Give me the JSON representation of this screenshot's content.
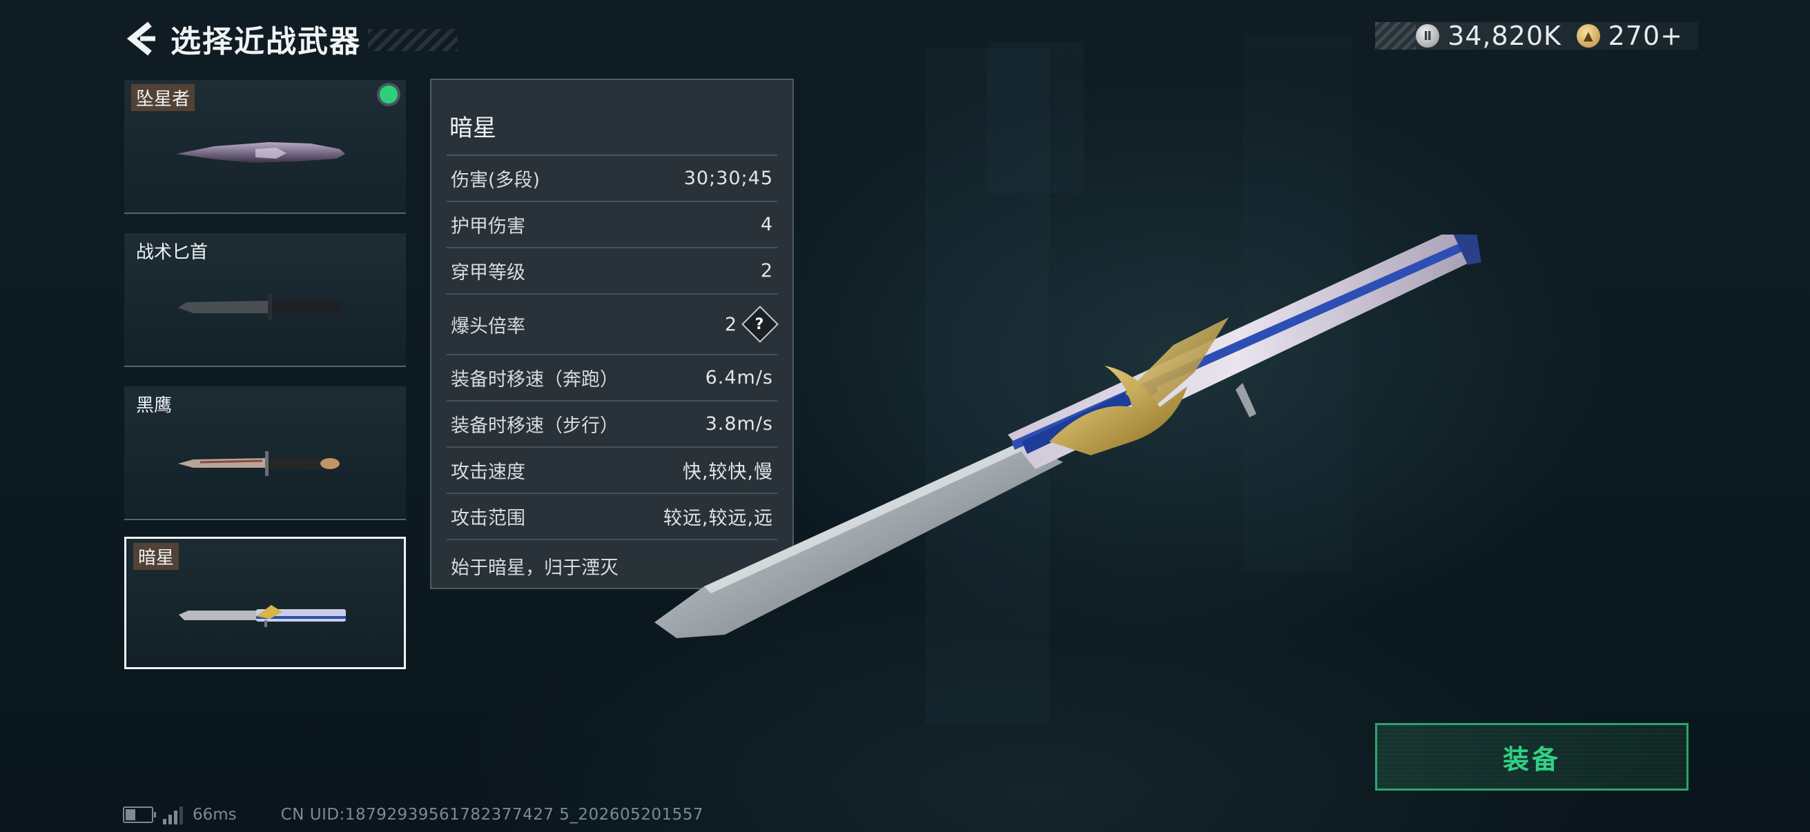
{
  "header": {
    "title": "选择近战武器"
  },
  "currency": {
    "silver": {
      "icon": "silver-coin-icon",
      "value": "34,820K"
    },
    "gold": {
      "icon": "gold-triangle-coin-icon",
      "value": "270+"
    }
  },
  "weapons": [
    {
      "name": "坠星者",
      "equipped": true,
      "selected": false
    },
    {
      "name": "战术匕首",
      "equipped": false,
      "selected": false
    },
    {
      "name": "黑鹰",
      "equipped": false,
      "selected": false
    },
    {
      "name": "暗星",
      "equipped": false,
      "selected": true
    }
  ],
  "stats": {
    "title": "暗星",
    "rows": [
      {
        "label": "伤害(多段)",
        "value": "30;30;45"
      },
      {
        "label": "护甲伤害",
        "value": "4"
      },
      {
        "label": "穿甲等级",
        "value": "2"
      },
      {
        "label": "爆头倍率",
        "value": "2",
        "help_icon": "?"
      },
      {
        "label": "装备时移速（奔跑）",
        "value": "6.4m/s"
      },
      {
        "label": "装备时移速（步行）",
        "value": "3.8m/s"
      },
      {
        "label": "攻击速度",
        "value": "快,较快,慢"
      },
      {
        "label": "攻击范围",
        "value": "较远,较远,远"
      }
    ],
    "flavor": "始于暗星，归于湮灭"
  },
  "equip_button": {
    "label": "装备"
  },
  "footer": {
    "ping": "66ms",
    "uid": "CN UID:18792939561782377427 5_202605201557"
  },
  "colors": {
    "accent_green": "#2ecf7b",
    "equip_border": "#2ea46a",
    "panel_bg": "#2c3439",
    "background": "#0f1c23"
  }
}
